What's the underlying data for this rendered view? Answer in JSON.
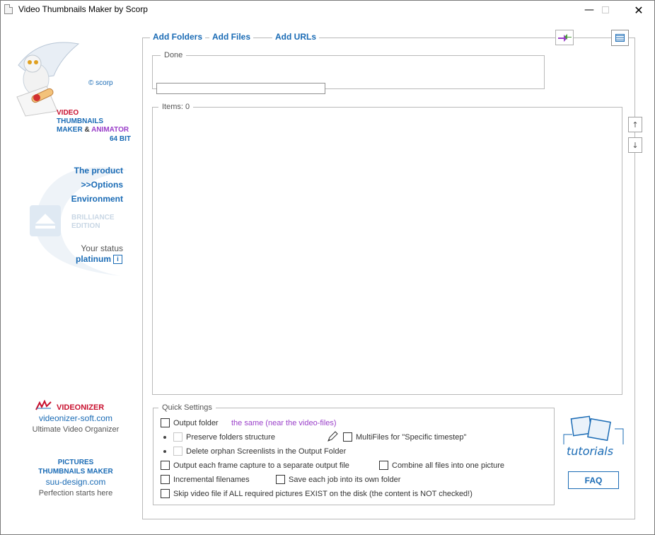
{
  "window": {
    "title": "Video Thumbnails Maker by Scorp",
    "minimize_icon": "minimize-icon",
    "maximize_icon": "maximize-icon",
    "close_icon": "close-icon"
  },
  "logo": {
    "copyright": "© scorp",
    "line1": "VIDEO",
    "line2": "THUMBNAILS",
    "line3a": "MAKER",
    "line3b": "&",
    "line3c": "ANIMATOR",
    "line4": "64 BIT"
  },
  "nav": {
    "product": "The product",
    "options": ">>Options",
    "environment": "Environment"
  },
  "edition": {
    "line1": "BRILLIANCE",
    "line2": "EDITION"
  },
  "status": {
    "label": "Your status",
    "value": "platinum",
    "info_icon": "info-icon"
  },
  "promos": [
    {
      "title": "VIDEONIZER",
      "url": "videonizer-soft.com",
      "tagline": "Ultimate Video Organizer"
    },
    {
      "title_line1": "PICTURES",
      "title_line2": "THUMBNAILS MAKER",
      "url": "suu-design.com",
      "tagline": "Perfection starts here"
    }
  ],
  "toolbar": {
    "add_folders": "Add Folders",
    "add_files": "Add Files",
    "add_urls": "Add URLs"
  },
  "status_group": {
    "label": "Done"
  },
  "items_group": {
    "label": "Items: 0"
  },
  "colors": {
    "link": "#1a6bb5",
    "accent_purple": "#9a3fc9",
    "logo_red": "#c8102e"
  },
  "quick_settings": {
    "label": "Quick Settings",
    "output_folder": "Output folder",
    "output_folder_value": "the same (near the video-files)",
    "preserve": "Preserve folders structure",
    "multifiles": "MultiFiles for \"Specific timestep\"",
    "delete_orphan": "Delete orphan Screenlists in the Output Folder",
    "each_frame": "Output each frame capture to a separate output file",
    "combine": "Combine all files into one picture",
    "incremental": "Incremental filenames",
    "save_job": "Save each job into its own folder",
    "skip": "Skip video file if ALL required pictures EXIST on the disk (the content is NOT checked!)"
  },
  "side": {
    "tutorials": "tutorials",
    "faq": "FAQ"
  }
}
